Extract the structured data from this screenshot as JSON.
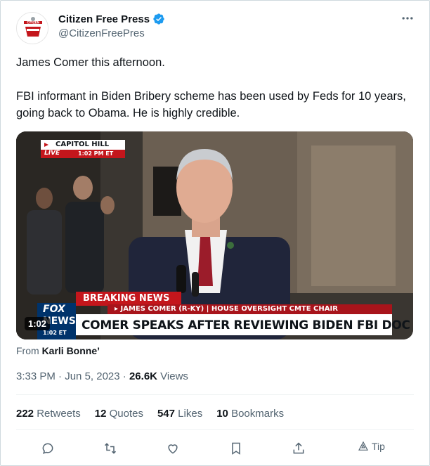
{
  "author": {
    "name": "Citizen Free Press",
    "handle": "@CitizenFreePres",
    "avatar_text": "CITIZEN"
  },
  "tweet": {
    "paragraphs": [
      "James Comer this afternoon.",
      "FBI informant in Biden Bribery scheme has been used by Feds for 10 years, going back to Obama. He is highly credible."
    ]
  },
  "video": {
    "location": "CAPITOL HILL",
    "live": "LIVE",
    "live_time": "1:02 PM ET",
    "breaking": "BREAKING NEWS",
    "subtitle": "▸ JAMES COMER (R-KY) | HOUSE OVERSIGHT CMTE CHAIR",
    "headline": "COMER SPEAKS AFTER REVIEWING BIDEN FBI DOC",
    "network_top": "FOX",
    "network_bottom": "NEWS",
    "bug_time": "1:02 ET",
    "duration": "1:02"
  },
  "from": {
    "prefix": "From",
    "source": "Karli Bonne’"
  },
  "meta": {
    "time": "3:33 PM",
    "date": "Jun 5, 2023",
    "views_count": "26.6K",
    "views_label": "Views"
  },
  "stats": {
    "retweets_count": "222",
    "retweets_label": "Retweets",
    "quotes_count": "12",
    "quotes_label": "Quotes",
    "likes_count": "547",
    "likes_label": "Likes",
    "bookmarks_count": "10",
    "bookmarks_label": "Bookmarks"
  },
  "actions": {
    "tip_label": "Tip"
  },
  "colors": {
    "verified": "#1d9bf0",
    "breaking_red": "#c4161c",
    "fox_blue": "#00336b"
  }
}
